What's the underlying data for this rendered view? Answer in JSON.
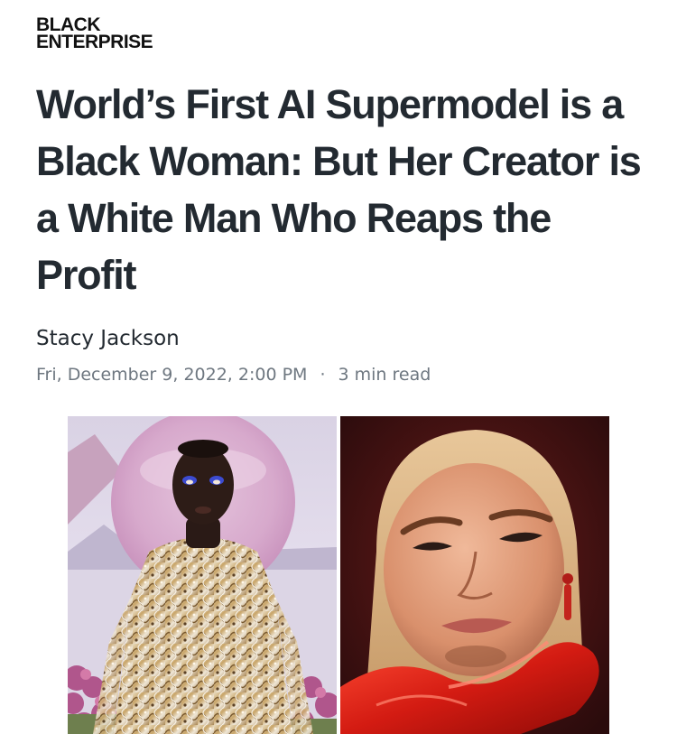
{
  "publication": {
    "logo_line1": "BLACK",
    "logo_line2": "ENTERPRISE"
  },
  "article": {
    "headline": "World’s First AI Supermodel is a Black Woman: But Her Creator is a White Man Who Reaps the Profit",
    "author": "Stacy Jackson",
    "date": "Fri, December 9, 2022, 2:00 PM",
    "separator": "·",
    "read_time": "3 min read"
  },
  "colors": {
    "headline": "#232a31",
    "meta": "#6e7780",
    "glove_red": "#d31b12"
  }
}
